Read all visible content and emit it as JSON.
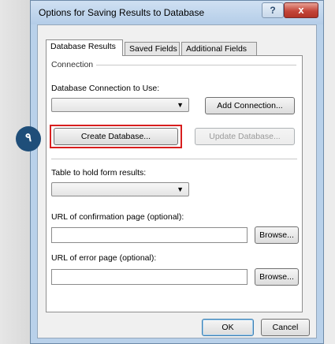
{
  "annotation": {
    "badge": "٩"
  },
  "dialog": {
    "title": "Options for Saving Results to Database",
    "help_glyph": "?",
    "close_glyph": "x"
  },
  "tabs": [
    {
      "label": "Database Results",
      "active": true
    },
    {
      "label": "Saved Fields",
      "active": false
    },
    {
      "label": "Additional Fields",
      "active": false
    }
  ],
  "connection": {
    "section_label": "Connection",
    "db_label": "Database Connection to Use:",
    "db_value": "",
    "add_connection": "Add Connection...",
    "create_database": "Create Database...",
    "update_database": "Update Database..."
  },
  "table": {
    "label": "Table to hold form results:",
    "value": ""
  },
  "confirmation_url": {
    "label": "URL of confirmation page (optional):",
    "value": "",
    "browse": "Browse..."
  },
  "error_url": {
    "label": "URL of error page (optional):",
    "value": "",
    "browse": "Browse..."
  },
  "footer": {
    "ok": "OK",
    "cancel": "Cancel"
  },
  "icons": {
    "dropdown": "chevron-down-icon"
  },
  "colors": {
    "highlight": "#d81e1e",
    "badge": "#1f4e79"
  }
}
